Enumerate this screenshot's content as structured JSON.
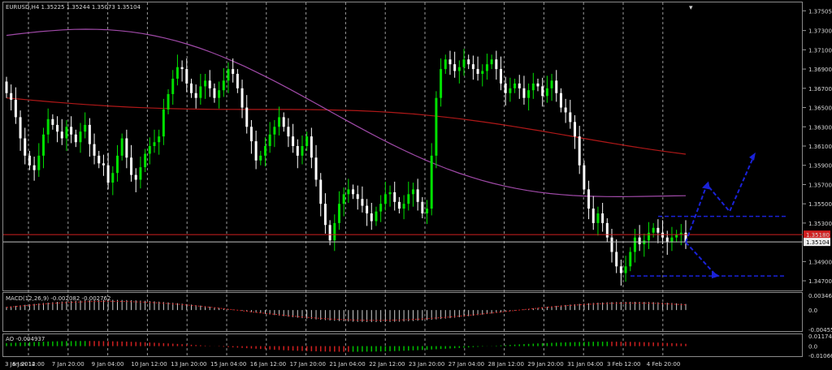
{
  "header": {
    "main": "EURUSD,H4 1.35225 1.35244 1.35073 1.35104",
    "macd": "MACD(12,26,9) -0.002082 -0.002762",
    "ao": "AO -0.004937"
  },
  "colors": {
    "bull": "#00e000",
    "bear": "#ffffff",
    "ma_slow": "#b01818",
    "ma_fast": "#a04aa8",
    "arrows": "#1a22d8",
    "resistance": "#d02020",
    "current_price": "#c0c0c0",
    "macd_hist": "#cfcfcf",
    "macd_signal": "#d02020",
    "ao_up": "#00c000",
    "ao_down": "#d02020"
  },
  "chart_data": [
    {
      "type": "candlestick",
      "symbol": "EURUSD",
      "timeframe": "H4",
      "ylim": [
        1.3465,
        1.3755
      ],
      "y_ticks": [
        "1.37505",
        "1.37300",
        "1.37100",
        "1.36900",
        "1.36700",
        "1.36500",
        "1.36300",
        "1.36100",
        "1.35900",
        "1.35700",
        "1.35500",
        "1.35300",
        "1.34900",
        "1.34700"
      ],
      "price_tags": {
        "resistance": {
          "value": 1.3518,
          "label": "1.35180"
        },
        "current": {
          "value": 1.35104,
          "label": "1.35104"
        }
      },
      "x_ticks": [
        "3 Jan 2014",
        "6 Jan 12:00",
        "7 Jan 20:00",
        "9 Jan 04:00",
        "10 Jan 12:00",
        "13 Jan 20:00",
        "15 Jan 04:00",
        "16 Jan 12:00",
        "17 Jan 20:00",
        "21 Jan 04:00",
        "22 Jan 12:00",
        "23 Jan 20:00",
        "27 Jan 04:00",
        "28 Jan 12:00",
        "29 Jan 20:00",
        "31 Jan 04:00",
        "3 Feb 12:00",
        "4 Feb 20:00"
      ],
      "closes": [
        1.3665,
        1.3658,
        1.364,
        1.3618,
        1.36,
        1.359,
        1.3585,
        1.36,
        1.3622,
        1.3638,
        1.3632,
        1.3625,
        1.3618,
        1.363,
        1.3622,
        1.3614,
        1.3625,
        1.3632,
        1.3612,
        1.36,
        1.3592,
        1.359,
        1.3572,
        1.3582,
        1.36,
        1.3618,
        1.3598,
        1.358,
        1.3575,
        1.3588,
        1.3602,
        1.361,
        1.3614,
        1.362,
        1.3648,
        1.3664,
        1.368,
        1.3692,
        1.369,
        1.3675,
        1.3665,
        1.366,
        1.3672,
        1.3678,
        1.367,
        1.366,
        1.3668,
        1.3678,
        1.369,
        1.3685,
        1.367,
        1.365,
        1.363,
        1.3615,
        1.3595,
        1.36,
        1.361,
        1.3622,
        1.363,
        1.364,
        1.363,
        1.362,
        1.361,
        1.36,
        1.361,
        1.362,
        1.3598,
        1.3575,
        1.355,
        1.3528,
        1.3512,
        1.353,
        1.355,
        1.356,
        1.3565,
        1.356,
        1.3555,
        1.3548,
        1.354,
        1.3532,
        1.3542,
        1.355,
        1.356,
        1.3562,
        1.3552,
        1.3545,
        1.355,
        1.356,
        1.3565,
        1.3552,
        1.354,
        1.3545,
        1.36,
        1.366,
        1.369,
        1.37,
        1.3695,
        1.3688,
        1.3692,
        1.37,
        1.3695,
        1.369,
        1.3685,
        1.3688,
        1.3695,
        1.37,
        1.369,
        1.3675,
        1.3665,
        1.367,
        1.3675,
        1.367,
        1.366,
        1.3668,
        1.3675,
        1.3672,
        1.3662,
        1.367,
        1.3678,
        1.3665,
        1.365,
        1.3645,
        1.3635,
        1.362,
        1.359,
        1.3565,
        1.3545,
        1.353,
        1.354,
        1.353,
        1.3515,
        1.35,
        1.3485,
        1.3478,
        1.3485,
        1.35,
        1.3515,
        1.3508,
        1.3512,
        1.352,
        1.3525,
        1.352,
        1.3515,
        1.351,
        1.3515,
        1.3518,
        1.352,
        1.351
      ],
      "ma_slow": {
        "start": 1.366,
        "end": 1.3612,
        "shape": "slow"
      },
      "ma_fast": {
        "start": 1.3725,
        "end": 1.3574,
        "shape": "fast"
      }
    },
    {
      "type": "histogram",
      "name": "MACD(12,26,9)",
      "values": [
        -0.002082,
        -0.002762
      ],
      "y_ticks": [
        "0.003461",
        "0.0",
        "-0.004550"
      ],
      "ylim": [
        -0.00455,
        0.003461
      ]
    },
    {
      "type": "histogram",
      "name": "AO",
      "values": [
        -0.004937
      ],
      "y_ticks": [
        "0.011749",
        "0.0",
        "-0.010666"
      ],
      "ylim": [
        -0.010666,
        0.011749
      ]
    }
  ]
}
